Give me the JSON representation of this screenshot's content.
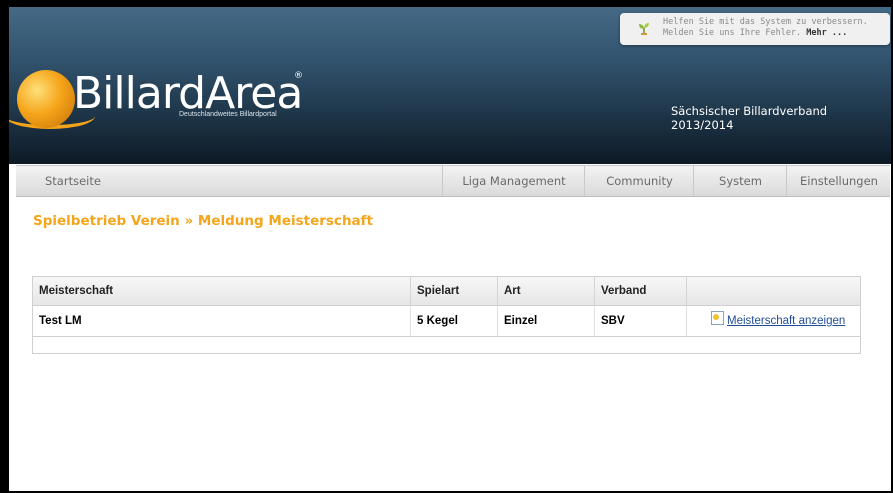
{
  "header": {
    "logo_text": "BillardArea",
    "logo_reg": "®",
    "logo_subtitle": "Deutschlandweites Billardportal",
    "verband": "Sächsischer Billardverband 2013/2014",
    "help": {
      "line1": "Helfen Sie mit das System zu verbessern.",
      "line2": "Melden Sie uns Ihre Fehler.",
      "more": "Mehr ...",
      "icon": "help-sprout-icon"
    }
  },
  "nav": {
    "home": "Startseite",
    "items": [
      "Liga Management",
      "Community",
      "System",
      "Einstellungen"
    ]
  },
  "page": {
    "title": "Spielbetrieb Verein » Meldung Meisterschaft"
  },
  "table": {
    "columns": [
      "Meisterschaft",
      "Spielart",
      "Art",
      "Verband",
      ""
    ],
    "rows": [
      {
        "meisterschaft": "Test LM",
        "spielart": "5 Kegel",
        "art": "Einzel",
        "verband": "SBV",
        "action": "Meisterschaft anzeigen",
        "action_icon": "document-icon"
      }
    ]
  },
  "colors": {
    "title": "#f4a51b",
    "link": "#1f4d9a",
    "header_top": "#456a86",
    "header_bottom": "#0d1a25"
  }
}
